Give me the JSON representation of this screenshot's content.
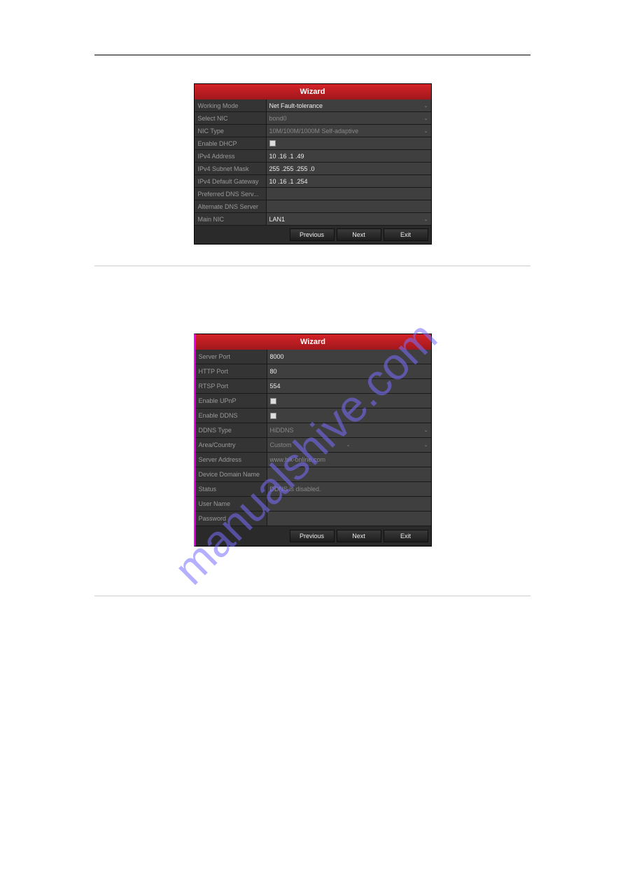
{
  "watermark_text": "manualshive.com",
  "wizard1": {
    "title": "Wizard",
    "rows": {
      "working_mode": {
        "label": "Working Mode",
        "value": "Net Fault-tolerance"
      },
      "select_nic": {
        "label": "Select NIC",
        "value": "bond0"
      },
      "nic_type": {
        "label": "NIC Type",
        "value": "10M/100M/1000M Self-adaptive"
      },
      "enable_dhcp": {
        "label": "Enable DHCP"
      },
      "ipv4_address": {
        "label": "IPv4 Address",
        "value": "10   .16   .1    .49"
      },
      "ipv4_subnet": {
        "label": "IPv4 Subnet Mask",
        "value": "255 .255 .255 .0"
      },
      "ipv4_gateway": {
        "label": "IPv4 Default Gateway",
        "value": "10   .16   .1    .254"
      },
      "pref_dns": {
        "label": "Preferred DNS Serv...",
        "value": ""
      },
      "alt_dns": {
        "label": "Alternate DNS Server",
        "value": ""
      },
      "main_nic": {
        "label": "Main NIC",
        "value": "LAN1"
      }
    },
    "buttons": {
      "previous": "Previous",
      "next": "Next",
      "exit": "Exit"
    }
  },
  "wizard2": {
    "title": "Wizard",
    "rows": {
      "server_port": {
        "label": "Server Port",
        "value": "8000"
      },
      "http_port": {
        "label": "HTTP Port",
        "value": "80"
      },
      "rtsp_port": {
        "label": "RTSP Port",
        "value": "554"
      },
      "enable_upnp": {
        "label": "Enable UPnP"
      },
      "enable_ddns": {
        "label": "Enable DDNS"
      },
      "ddns_type": {
        "label": "DDNS Type",
        "value": "HiDDNS"
      },
      "area_country": {
        "label": "Area/Country",
        "value": "Custom"
      },
      "server_address": {
        "label": "Server Address",
        "value": "www.hik-online.com"
      },
      "device_domain": {
        "label": "Device Domain Name",
        "value": ""
      },
      "status": {
        "label": "Status",
        "value": "DDNS is disabled."
      },
      "user_name": {
        "label": "User Name",
        "value": ""
      },
      "password": {
        "label": "Password",
        "value": ""
      }
    },
    "buttons": {
      "previous": "Previous",
      "next": "Next",
      "exit": "Exit"
    }
  }
}
